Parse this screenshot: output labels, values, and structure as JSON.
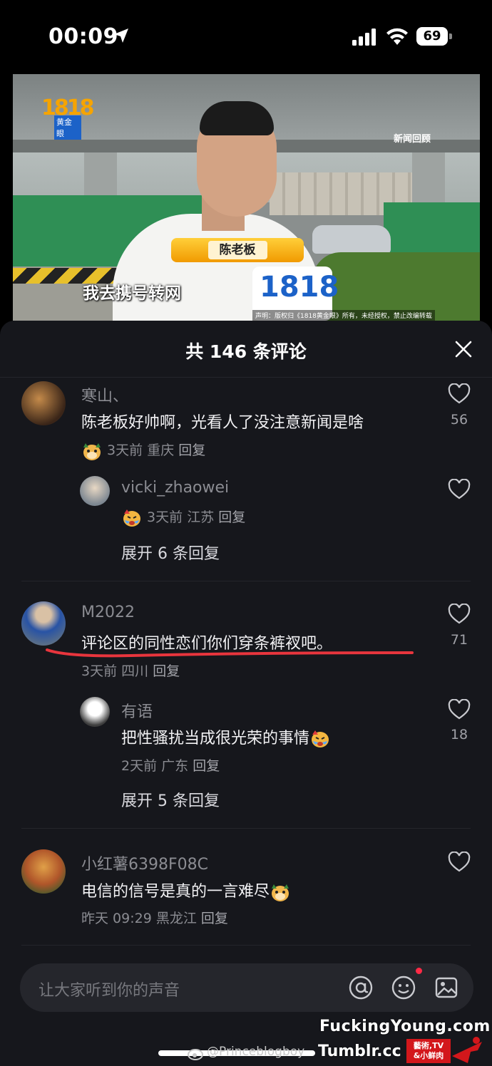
{
  "status_bar": {
    "time": "00:09",
    "battery": "69"
  },
  "video": {
    "logo_text": "1818",
    "logo_tag": "黄金眼",
    "news_tag": "新闻回顾",
    "name_tag": "陈老板",
    "subtitle": "我去携号转网",
    "mic_text": "1818",
    "disclaimer": "声明：版权归《1818黄金眼》所有，未经授权，禁止改编转载"
  },
  "comments_panel": {
    "title": "共 146 条评论",
    "comments": [
      {
        "user": "寒山、",
        "text": "陈老板好帅啊，光看人了没注意新闻是啥",
        "time": "3天前",
        "location": "重庆",
        "reply_label": "回复",
        "likes": "56",
        "replies": [
          {
            "user": "vicki_zhaowei",
            "text": "",
            "time": "3天前",
            "location": "江苏",
            "reply_label": "回复"
          }
        ],
        "expand_label": "展开 6 条回复"
      },
      {
        "user": "M2022",
        "text": "评论区的同性恋们你们穿条裤衩吧。",
        "time": "3天前",
        "location": "四川",
        "reply_label": "回复",
        "likes": "71",
        "replies": [
          {
            "user": "有语",
            "text": "把性骚扰当成很光荣的事情",
            "time": "2天前",
            "location": "广东",
            "reply_label": "回复",
            "likes": "18"
          }
        ],
        "expand_label": "展开 5 条回复"
      },
      {
        "user": "小红薯6398F08C",
        "text": "电信的信号是真的一言难尽",
        "time": "昨天 09:29",
        "location": "黑龙江",
        "reply_label": "回复",
        "likes": ""
      }
    ]
  },
  "input": {
    "placeholder": "让大家听到你的声音"
  },
  "watermark": {
    "site": "FuckingYoung.com",
    "handle": "@Princeblogboy",
    "tumblr": "Tumblr.cc",
    "badge_line1": "藝術,TV",
    "badge_line2": "&小鲜肉"
  },
  "colors": {
    "panel_bg": "#16171c",
    "accent_red": "#ff2a46",
    "underline": "#e8353d"
  }
}
